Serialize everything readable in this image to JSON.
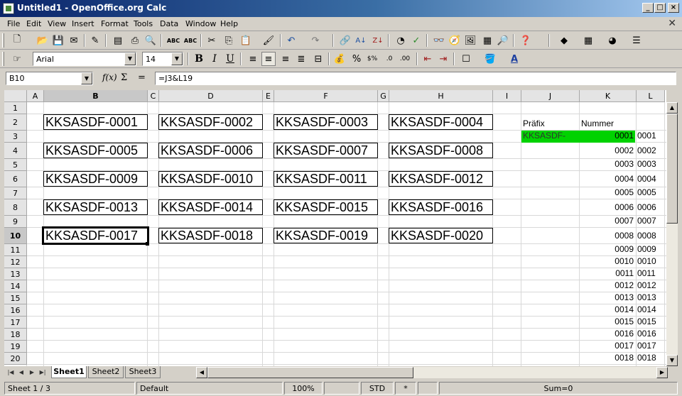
{
  "window": {
    "title": "Untitled1 - OpenOffice.org Calc"
  },
  "menu": [
    "File",
    "Edit",
    "View",
    "Insert",
    "Format",
    "Tools",
    "Data",
    "Window",
    "Help"
  ],
  "toolbar": {
    "font_name": "Arial",
    "font_size": "14",
    "bold_label": "B",
    "italic_label": "I",
    "underline_label": "U"
  },
  "formula": {
    "cell_ref": "B10",
    "fx_label": "f(x)",
    "sum_label": "Σ",
    "equals_label": "=",
    "content": "=J3&L19"
  },
  "columns": [
    "A",
    "B",
    "C",
    "D",
    "E",
    "F",
    "G",
    "H",
    "I",
    "J",
    "K",
    "L"
  ],
  "rows": [
    "1",
    "2",
    "3",
    "4",
    "5",
    "6",
    "7",
    "8",
    "9",
    "10",
    "11",
    "12",
    "13",
    "14",
    "15",
    "16",
    "17",
    "18",
    "19",
    "20"
  ],
  "selected": {
    "column": "B",
    "row": "10"
  },
  "labels": [
    [
      "KKSASDF-0001",
      "KKSASDF-0002",
      "KKSASDF-0003",
      "KKSASDF-0004"
    ],
    [
      "KKSASDF-0005",
      "KKSASDF-0006",
      "KKSASDF-0007",
      "KKSASDF-0008"
    ],
    [
      "KKSASDF-0009",
      "KKSASDF-0010",
      "KKSASDF-0011",
      "KKSASDF-0012"
    ],
    [
      "KKSASDF-0013",
      "KKSASDF-0014",
      "KKSASDF-0015",
      "KKSASDF-0016"
    ],
    [
      "KKSASDF-0017",
      "KKSASDF-0018",
      "KKSASDF-0019",
      "KKSASDF-0020"
    ]
  ],
  "side": {
    "prefix_header": "Präfix",
    "number_header": "Nummer",
    "prefix_value": "KKSASDF-",
    "k_values": [
      "0001",
      "0002",
      "0003",
      "0004",
      "0005",
      "0006",
      "0007",
      "0008",
      "0009",
      "0010",
      "0011",
      "0012",
      "0013",
      "0014",
      "0015",
      "0016",
      "0017",
      "0018"
    ],
    "l_values": [
      "0001",
      "0002",
      "0003",
      "0004",
      "0005",
      "0006",
      "0007",
      "0008",
      "0009",
      "0010",
      "0011",
      "0012",
      "0013",
      "0014",
      "0015",
      "0016",
      "0017",
      "0018"
    ],
    "highlight_color": "#00d200"
  },
  "sheets": [
    "Sheet1",
    "Sheet2",
    "Sheet3"
  ],
  "status": {
    "sheet": "Sheet 1 / 3",
    "style": "Default",
    "zoom": "100%",
    "mode": "STD",
    "modified": "*",
    "sum": "Sum=0"
  }
}
